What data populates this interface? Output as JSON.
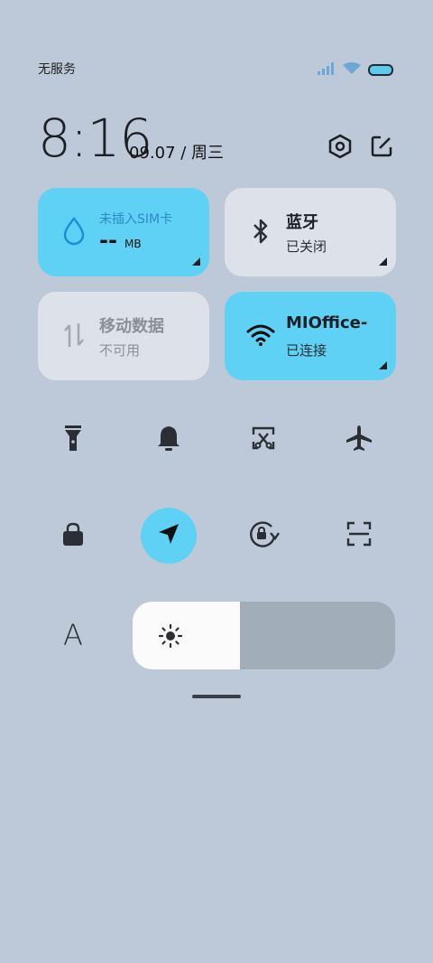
{
  "status_bar": {
    "carrier": "无服务",
    "icons": [
      "signal-icon",
      "wifi-icon",
      "battery-icon"
    ]
  },
  "header": {
    "time": "8:16",
    "date": "09.07 / 周三",
    "buttons": [
      "settings-icon",
      "edit-icon"
    ]
  },
  "tiles": {
    "data_usage": {
      "title": "未插入SIM卡",
      "value": "--",
      "unit": "MB",
      "state": "on"
    },
    "bluetooth": {
      "title": "蓝牙",
      "subtitle": "已关闭",
      "state": "off"
    },
    "mobile_data": {
      "title": "移动数据",
      "subtitle": "不可用",
      "state": "disabled"
    },
    "wifi": {
      "title": "MIOffice-",
      "subtitle": "已连接",
      "state": "on"
    }
  },
  "toggles_row1": [
    "flashlight-icon",
    "bell-icon",
    "screenshot-icon",
    "airplane-icon"
  ],
  "toggles_row2": [
    "lock-icon",
    "location-icon",
    "rotation-lock-icon",
    "scan-icon"
  ],
  "toggles_row2_active": "location-icon",
  "brightness": {
    "level": 0.41,
    "auto_label": "A"
  },
  "colors": {
    "accent": "#5fd1f5",
    "background": "#bdc9d8",
    "tile_off": "#dde2ea"
  }
}
